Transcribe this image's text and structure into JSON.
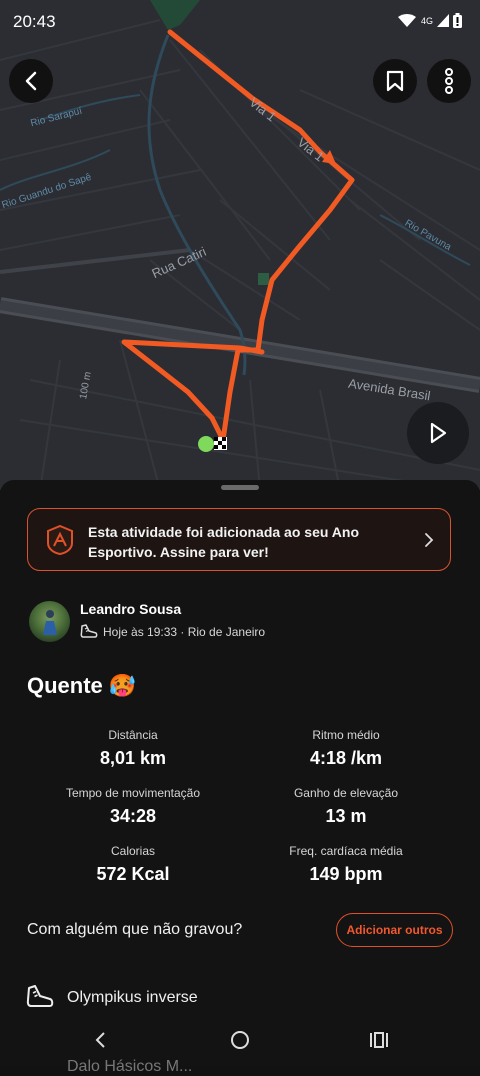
{
  "status_bar": {
    "time": "20:43",
    "network": "4G"
  },
  "map": {
    "labels": {
      "via1_a": "Via 1",
      "via1_b": "Via 1",
      "rio_sarapui": "Rio Sarapuí",
      "rio_guandu": "Rio Guandu do Sapê",
      "rio_pavuna": "Rio Pavuna",
      "rua_catiri": "Rua Catiri",
      "avenida_brasil": "Avenida Brasil",
      "elevation": "100 m"
    },
    "route_color": "#f15a22"
  },
  "icons": {
    "back": "chevron-left-icon",
    "bookmark": "bookmark-icon",
    "more": "more-vertical-icon",
    "play": "play-icon",
    "year_badge": "trophy-badge-icon",
    "banner_chevron": "chevron-right-icon",
    "shoe": "shoe-icon"
  },
  "banner": {
    "text": "Esta atividade foi adicionada ao seu Ano Esportivo. Assine para ver!"
  },
  "activity": {
    "user_name": "Leandro Sousa",
    "meta": "Hoje às 19:33 · Rio de Janeiro",
    "title": "Quente 🥵"
  },
  "stats": {
    "distance": {
      "label": "Distância",
      "value": "8,01 km"
    },
    "pace": {
      "label": "Ritmo médio",
      "value": "4:18 /km"
    },
    "moving_time": {
      "label": "Tempo de movimentação",
      "value": "34:28"
    },
    "elevation_gain": {
      "label": "Ganho de elevação",
      "value": "13 m"
    },
    "calories": {
      "label": "Calorias",
      "value": "572 Kcal"
    },
    "heart_rate": {
      "label": "Freq. cardíaca média",
      "value": "149 bpm"
    }
  },
  "with_others": {
    "text": "Com alguém que não gravou?",
    "button": "Adicionar outros"
  },
  "gear": {
    "name": "Olympikus inverse"
  },
  "partial_row": {
    "text": "Dalo Hásicos M..."
  },
  "colors": {
    "accent": "#f15a22",
    "background": "#131313"
  }
}
